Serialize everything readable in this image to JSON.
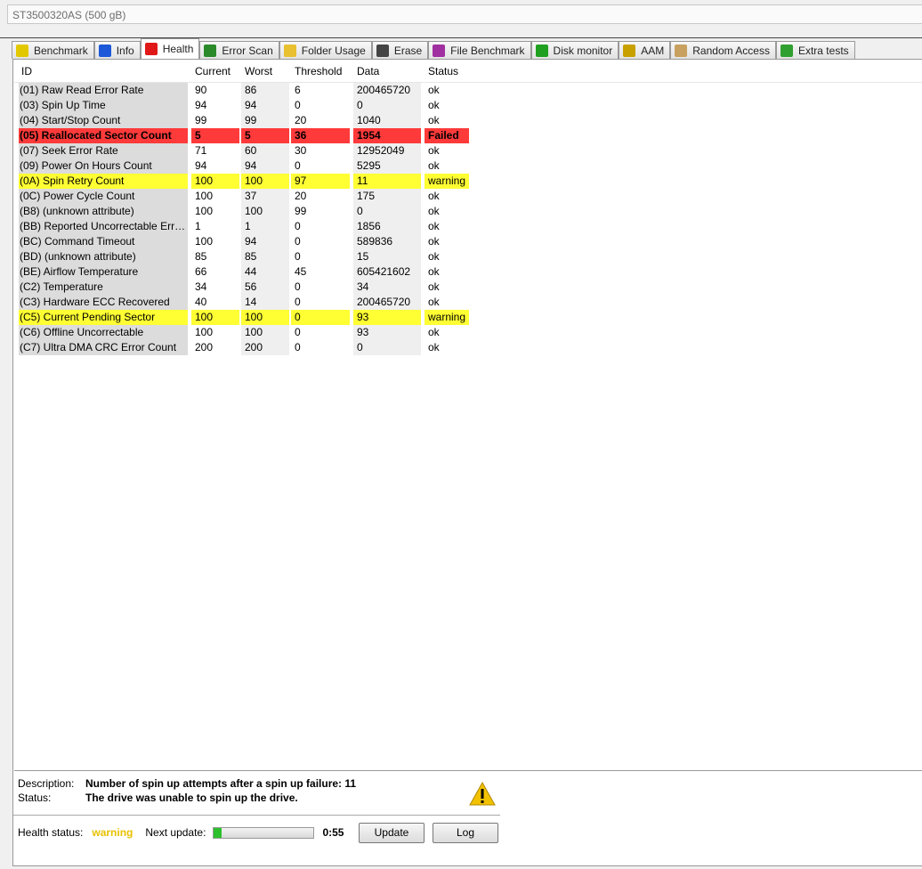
{
  "drive": "ST3500320AS (500 gB)",
  "tabs": [
    {
      "label": "Benchmark",
      "icon": "lightbulb-icon",
      "color": "#e2c800"
    },
    {
      "label": "Info",
      "icon": "info-icon",
      "color": "#1c58d8"
    },
    {
      "label": "Health",
      "icon": "red-cross-icon",
      "color": "#e01818"
    },
    {
      "label": "Error Scan",
      "icon": "magnifier-icon",
      "color": "#2a8a2a"
    },
    {
      "label": "Folder Usage",
      "icon": "folder-icon",
      "color": "#e8c030"
    },
    {
      "label": "Erase",
      "icon": "trash-icon",
      "color": "#444444"
    },
    {
      "label": "File Benchmark",
      "icon": "file-icon",
      "color": "#a030a0"
    },
    {
      "label": "Disk monitor",
      "icon": "monitor-chart-icon",
      "color": "#20a020"
    },
    {
      "label": "AAM",
      "icon": "speaker-icon",
      "color": "#c8a000"
    },
    {
      "label": "Random Access",
      "icon": "dice-icon",
      "color": "#c8a060"
    },
    {
      "label": "Extra tests",
      "icon": "extra-tests-icon",
      "color": "#30a030"
    }
  ],
  "active_tab": 2,
  "columns": [
    "ID",
    "Current",
    "Worst",
    "Threshold",
    "Data",
    "Status"
  ],
  "rows": [
    [
      "(01) Raw Read Error Rate",
      "90",
      "86",
      "6",
      "200465720",
      "ok"
    ],
    [
      "(03) Spin Up Time",
      "94",
      "94",
      "0",
      "0",
      "ok"
    ],
    [
      "(04) Start/Stop Count",
      "99",
      "99",
      "20",
      "1040",
      "ok"
    ],
    [
      "(05) Reallocated Sector Count",
      "5",
      "5",
      "36",
      "1954",
      "Failed"
    ],
    [
      "(07) Seek Error Rate",
      "71",
      "60",
      "30",
      "12952049",
      "ok"
    ],
    [
      "(09) Power On Hours Count",
      "94",
      "94",
      "0",
      "5295",
      "ok"
    ],
    [
      "(0A) Spin Retry Count",
      "100",
      "100",
      "97",
      "11",
      "warning"
    ],
    [
      "(0C) Power Cycle Count",
      "100",
      "37",
      "20",
      "175",
      "ok"
    ],
    [
      "(B8) (unknown attribute)",
      "100",
      "100",
      "99",
      "0",
      "ok"
    ],
    [
      "(BB) Reported Uncorrectable Errors",
      "1",
      "1",
      "0",
      "1856",
      "ok"
    ],
    [
      "(BC) Command Timeout",
      "100",
      "94",
      "0",
      "589836",
      "ok"
    ],
    [
      "(BD) (unknown attribute)",
      "85",
      "85",
      "0",
      "15",
      "ok"
    ],
    [
      "(BE) Airflow Temperature",
      "66",
      "44",
      "45",
      "605421602",
      "ok"
    ],
    [
      "(C2) Temperature",
      "34",
      "56",
      "0",
      "34",
      "ok"
    ],
    [
      "(C3) Hardware ECC Recovered",
      "40",
      "14",
      "0",
      "200465720",
      "ok"
    ],
    [
      "(C5) Current Pending Sector",
      "100",
      "100",
      "0",
      "93",
      "warning"
    ],
    [
      "(C6) Offline Uncorrectable",
      "100",
      "100",
      "0",
      "93",
      "ok"
    ],
    [
      "(C7) Ultra DMA CRC Error Count",
      "200",
      "200",
      "0",
      "0",
      "ok"
    ]
  ],
  "description": {
    "label": "Description:",
    "value": "Number of spin up attempts after a spin up failure: 11",
    "status_label": "Status:",
    "status_value": "The drive was unable to spin up the drive."
  },
  "footer": {
    "health_label": "Health status:",
    "health_value": "warning",
    "next_label": "Next update:",
    "progress": 0.08,
    "time": "0:55",
    "update": "Update",
    "log": "Log"
  },
  "colors": {
    "failed": "#ff3a3a",
    "warning": "#ffff33"
  }
}
